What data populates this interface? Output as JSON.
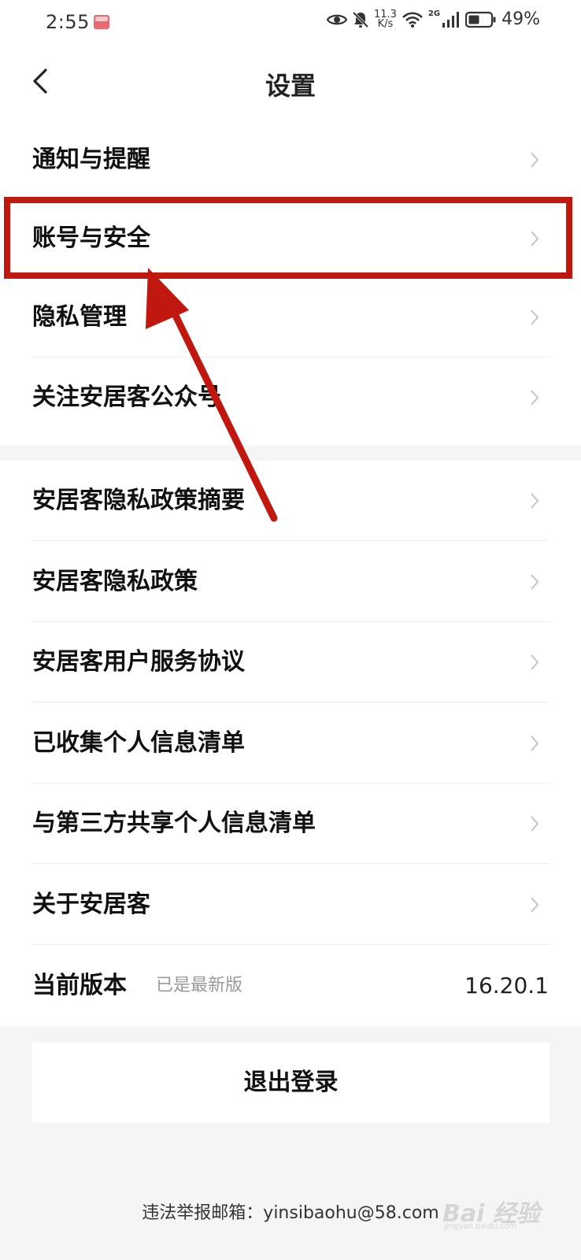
{
  "status_bar": {
    "time": "2:55",
    "speed_value": "11.3",
    "speed_unit": "K/s",
    "network_type": "2G",
    "battery_percent": "49%",
    "icons": [
      "eye-icon",
      "mute-bell-icon",
      "wifi-icon",
      "signal-icon",
      "battery-icon"
    ]
  },
  "nav": {
    "title": "设置",
    "back_icon": "chevron-left-icon"
  },
  "section1": {
    "items": [
      {
        "label": "通知与提醒"
      },
      {
        "label": "账号与安全"
      },
      {
        "label": "隐私管理"
      },
      {
        "label": "关注安居客公众号"
      }
    ]
  },
  "section2": {
    "items": [
      {
        "label": "安居客隐私政策摘要"
      },
      {
        "label": "安居客隐私政策"
      },
      {
        "label": "安居客用户服务协议"
      },
      {
        "label": "已收集个人信息清单"
      },
      {
        "label": "与第三方共享个人信息清单"
      },
      {
        "label": "关于安居客"
      }
    ]
  },
  "version": {
    "label": "当前版本",
    "status": "已是最新版",
    "number": "16.20.1"
  },
  "logout": {
    "label": "退出登录"
  },
  "footer": {
    "report_label": "违法举报邮箱：",
    "report_email": "yinsibaohu@58.com"
  },
  "watermark": {
    "text": "Bai 经验",
    "sub": "jingyan.baidu.com"
  },
  "colors": {
    "annotation": "#c0170f",
    "background": "#f5f5f5"
  }
}
